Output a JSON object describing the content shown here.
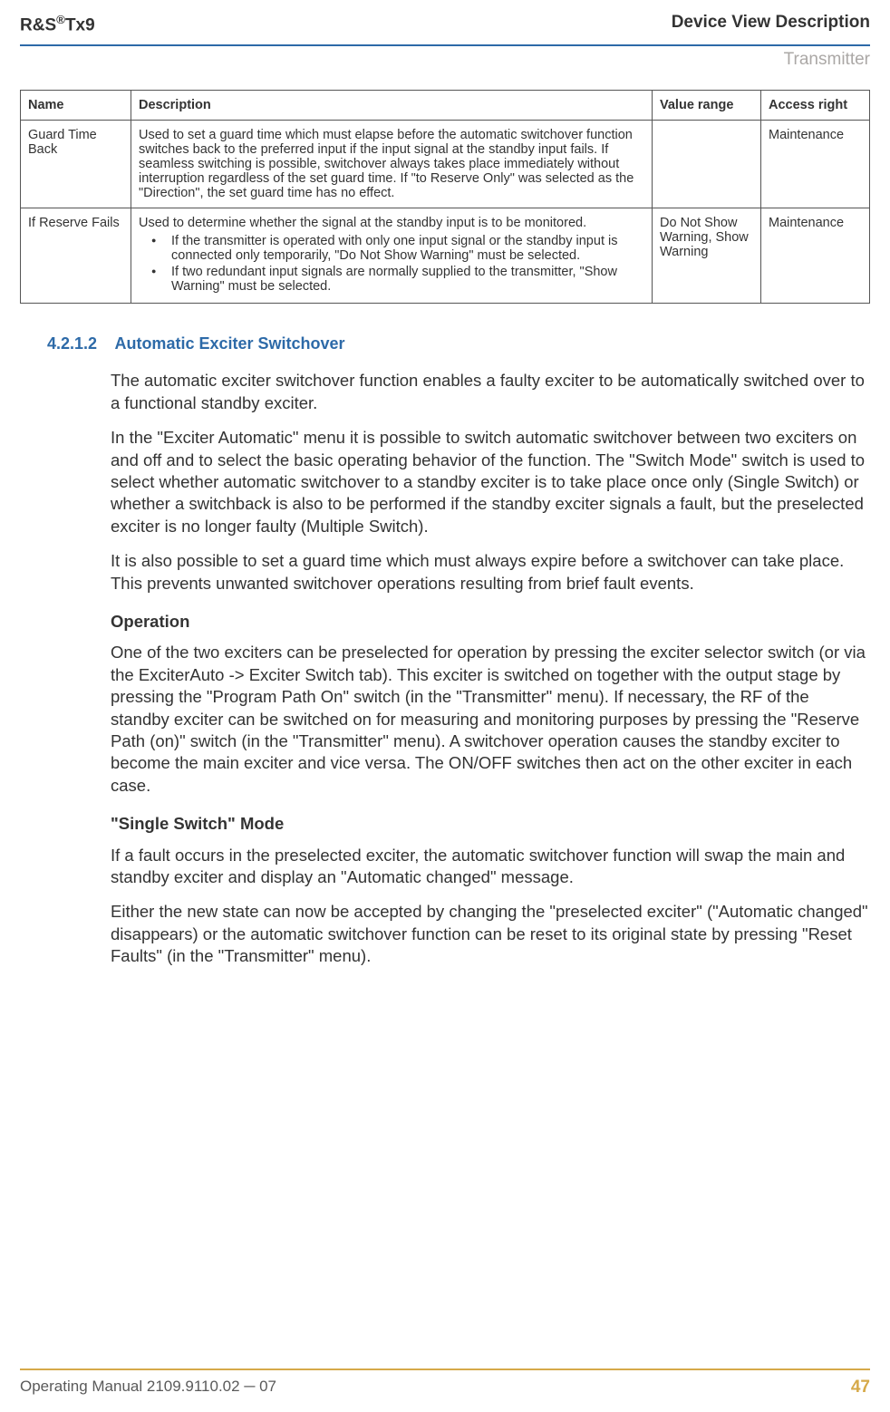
{
  "header": {
    "product_prefix": "R&S",
    "product_model": "Tx9",
    "title_right": "Device View Description",
    "subtitle_right": "Transmitter"
  },
  "table": {
    "headers": {
      "name": "Name",
      "description": "Description",
      "value_range": "Value range",
      "access_right": "Access right"
    },
    "rows": [
      {
        "name": "Guard Time Back",
        "description": "Used to set a guard time which must elapse before the automatic switchover function switches back to the preferred input if the input signal at the standby input fails. If seamless switching is possible, switchover always takes place immediately without interruption regardless of the set guard time. If \"to Reserve Only\" was selected as the \"Direction\", the set guard time has no effect.",
        "value_range": "",
        "access_right": "Maintenance"
      },
      {
        "name": "If Reserve Fails",
        "description_intro": "Used to determine whether the signal at the standby input is to be monitored.",
        "bullets": [
          "If the transmitter is operated with only one input signal or the standby input is connected only temporarily, \"Do Not Show Warning\" must be selected.",
          "If two redundant input signals are normally supplied to the transmitter, \"Show Warning\" must be selected."
        ],
        "value_range": "Do Not Show Warning, Show Warning",
        "access_right": "Maintenance"
      }
    ]
  },
  "section": {
    "number": "4.2.1.2",
    "title": "Automatic Exciter Switchover",
    "paragraphs_intro": [
      "The automatic exciter switchover function enables a faulty exciter to be automatically switched over to a functional standby exciter.",
      "In the \"Exciter Automatic\" menu it is possible to switch automatic switchover between two exciters on and off and to select the basic operating behavior of the function. The \"Switch Mode\" switch is used to select whether automatic switchover to a standby exciter is to take place once only (Single Switch) or whether a switchback is also to be performed if the standby exciter signals a fault, but the preselected exciter is no longer faulty (Multiple Switch).",
      "It is also possible to set a guard time which must always expire before a switchover can take place. This prevents unwanted switchover operations resulting from brief fault events."
    ],
    "operation_heading": "Operation",
    "operation_text": "One of the two exciters can be preselected for operation by pressing the exciter selector switch (or via the ExciterAuto -> Exciter Switch tab). This exciter is switched on together with the output stage by pressing the \"Program Path On\" switch (in the \"Transmitter\" menu). If necessary, the RF of the standby exciter can be switched on for measuring and monitoring purposes by pressing the \"Reserve Path (on)\" switch (in the \"Transmitter\" menu). A switchover operation causes the standby exciter to become the main exciter and vice versa. The ON/OFF switches then act on the other exciter in each case.",
    "single_switch_heading": "\"Single Switch\" Mode",
    "single_switch_paragraphs": [
      "If a fault occurs in the preselected exciter, the automatic switchover function will swap the main and standby exciter and display an \"Automatic changed\" message.",
      "Either the new state can now be accepted by changing the \"preselected exciter\" (\"Automatic changed\" disappears) or the automatic switchover function can be reset to its original state by pressing \"Reset Faults\" (in the \"Transmitter\" menu)."
    ]
  },
  "footer": {
    "manual": "Operating Manual 2109.9110.02 ─ 07",
    "page": "47"
  }
}
